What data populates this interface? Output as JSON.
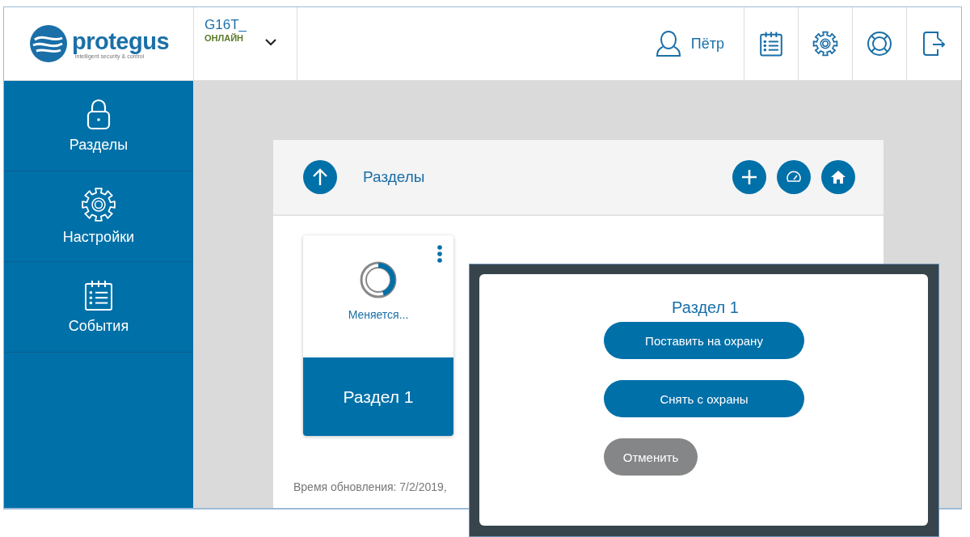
{
  "header": {
    "logo": {
      "name": "protegus",
      "tagline": "intelligent security & control"
    },
    "device": {
      "name": "G16T_",
      "status": "ОНЛАЙН",
      "online": true
    },
    "user": "Пётр"
  },
  "sidebar": {
    "items": [
      {
        "label": "Разделы"
      },
      {
        "label": "Настройки"
      },
      {
        "label": "События"
      }
    ]
  },
  "panel": {
    "title": "Разделы",
    "sections": [
      {
        "name": "Раздел 1",
        "status": "Меняется..."
      }
    ],
    "updated": "Время обновления: 7/2/2019,"
  },
  "dialog": {
    "title": "Раздел 1",
    "buttons": [
      {
        "label": "Поставить на охрану",
        "kind": "primary"
      },
      {
        "label": "Снять с охраны",
        "kind": "primary"
      },
      {
        "label": "Отменить",
        "kind": "cancel"
      }
    ]
  }
}
